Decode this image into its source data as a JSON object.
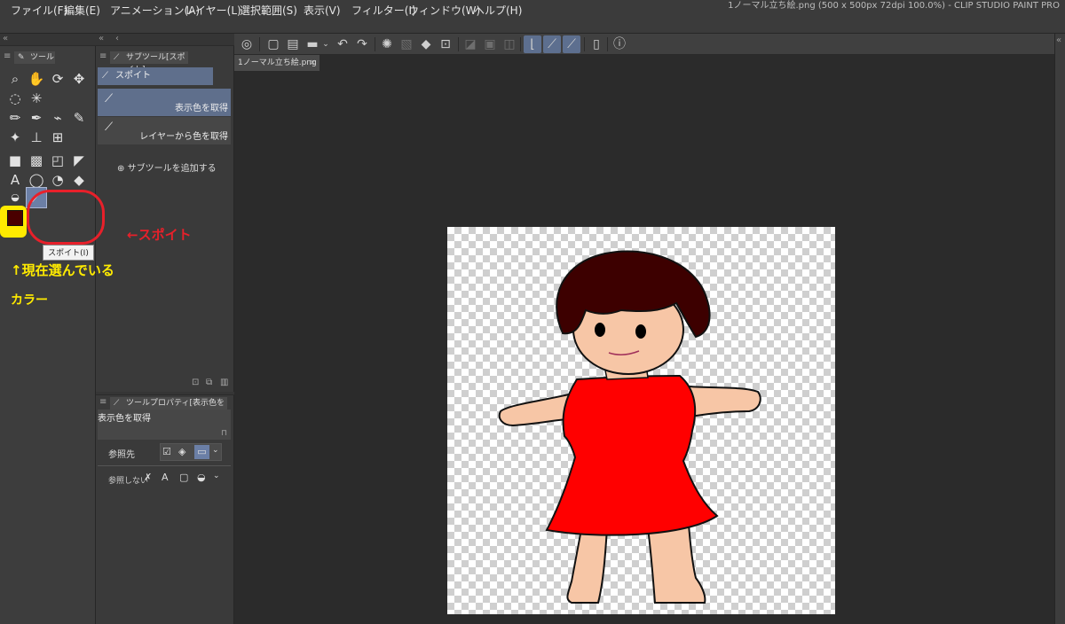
{
  "menu": [
    "ファイル(F)",
    "編集(E)",
    "アニメーション(A)",
    "レイヤー(L)",
    "選択範囲(S)",
    "表示(V)",
    "フィルター(I)",
    "ウィンドウ(W)",
    "ヘルプ(H)"
  ],
  "window_title": "1ノーマル立ち絵.png (500 x 500px 72dpi 100.0%)  - CLIP STUDIO PAINT PRO",
  "tool_panel": {
    "tab": "ツール",
    "tooltip": "スポイト(I)"
  },
  "sub_tool": {
    "tab": "サブツール[スポイト]",
    "group": "スポイト",
    "items": [
      "表示色を取得",
      "レイヤーから色を取得"
    ],
    "add": "サブツールを追加する"
  },
  "tool_property": {
    "tab": "ツールプロパティ[表示色を取得]",
    "name": "表示色を取得",
    "ref_label": "参照先",
    "no_ref_label": "参照しない"
  },
  "document": {
    "tab": "1ノーマル立ち絵.png"
  },
  "annotations": {
    "eyedropper": "←スポイト",
    "current_color_1": "↑現在選んでいる",
    "current_color_2": "カラー"
  },
  "colors": {
    "current_color": "#4a0000",
    "dress": "#ff0000",
    "skin": "#f7c6a6",
    "hair": "#3d0000",
    "annotation_red": "#e8202a",
    "annotation_yellow": "#ffeb00"
  }
}
